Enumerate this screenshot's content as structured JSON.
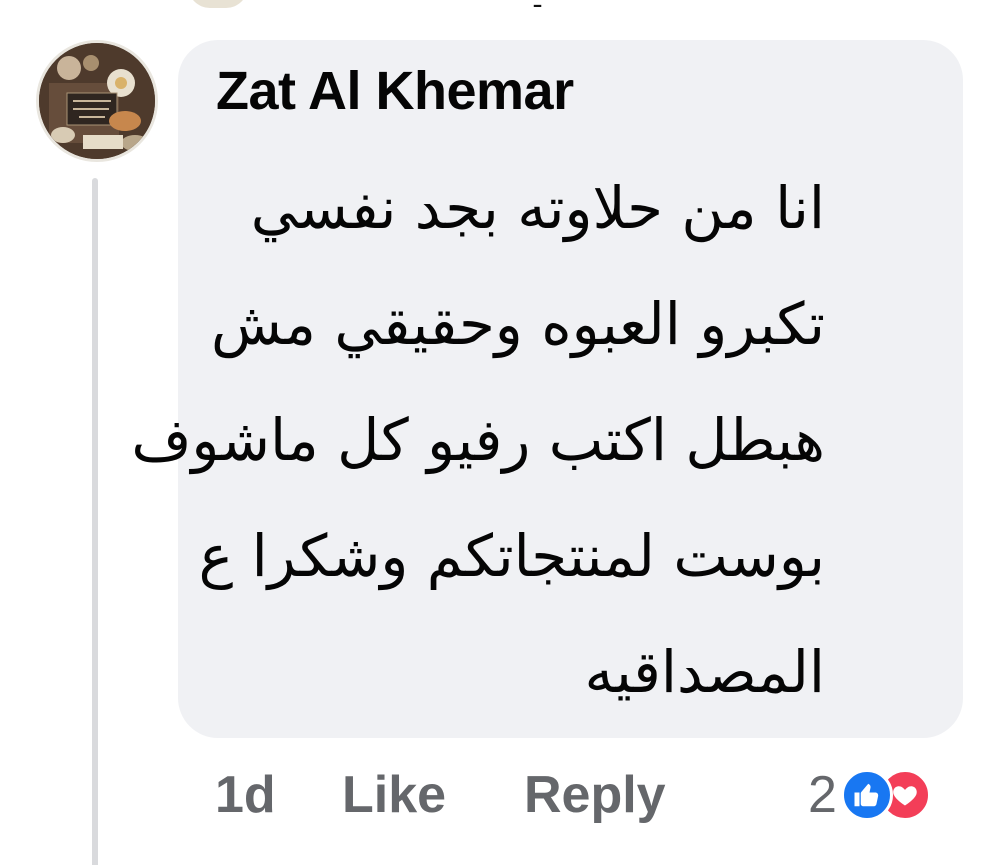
{
  "comment": {
    "author": "Zat Al Khemar",
    "text_lines": [
      "انا من حلاوته بجد نفسي",
      "تكبرو العبوه وحقيقي مش",
      "هبطل اكتب رفيو كل ماشوف",
      "بوست لمنتجاتكم وشكرا ع",
      "المصداقيه"
    ],
    "time": "1d",
    "like_label": "Like",
    "reply_label": "Reply",
    "reaction_count": "2",
    "reactions": [
      "like-icon",
      "love-icon"
    ]
  },
  "colors": {
    "bubble": "#f0f1f4",
    "text": "#050505",
    "meta": "#65676b",
    "like_blue": "#1877f2",
    "love_red": "#f33e58"
  }
}
